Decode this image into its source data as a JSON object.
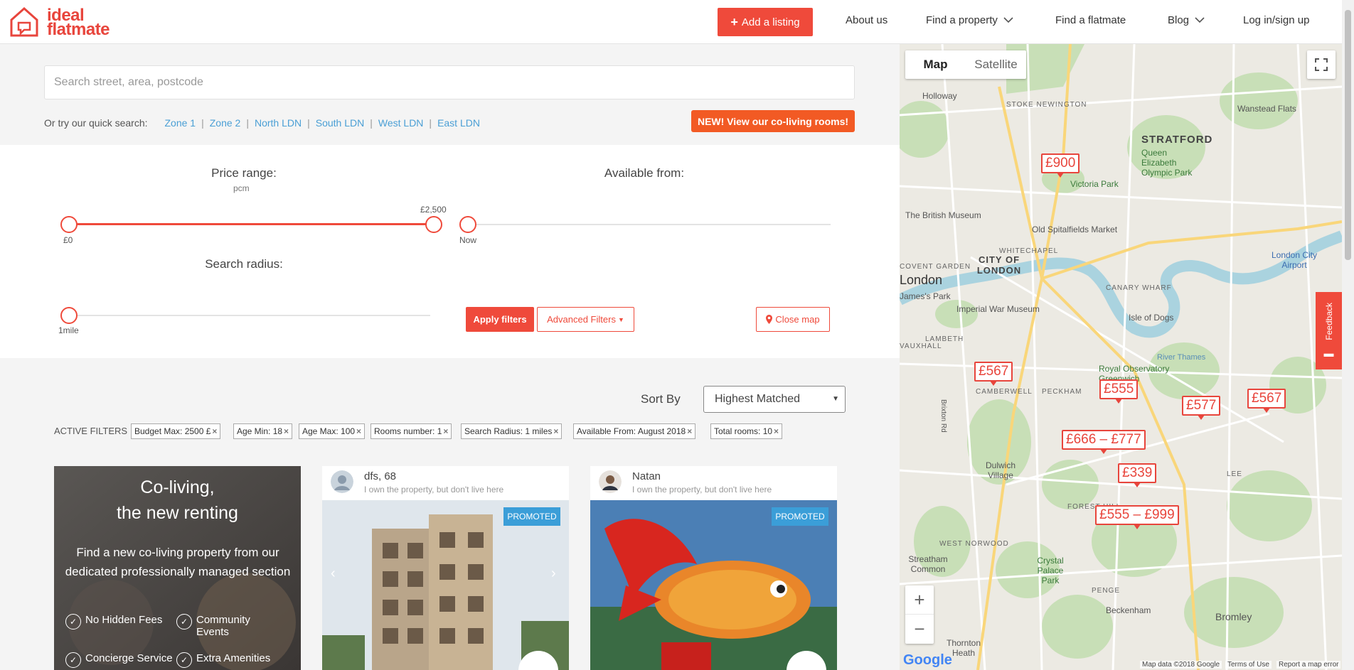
{
  "header": {
    "logo_line1": "ideal",
    "logo_line2": "flatmate",
    "add_listing": "Add a listing",
    "nav": [
      {
        "label": "About us"
      },
      {
        "label": "Find a property"
      },
      {
        "label": "Find a flatmate"
      },
      {
        "label": "Blog"
      },
      {
        "label": "Log in/sign up"
      }
    ]
  },
  "search": {
    "placeholder": "Search street, area, postcode",
    "quick_label": "Or try our quick search:",
    "quick_links": [
      "Zone 1",
      "Zone 2",
      "North LDN",
      "South LDN",
      "West LDN",
      "East LDN"
    ],
    "coliving_button": "NEW! View our co-living rooms!"
  },
  "filters": {
    "price_label": "Price range:",
    "price_unit": "pcm",
    "price_min_label": "£0",
    "price_max_label": "£2,500",
    "price_min": 0,
    "price_max": 2500,
    "available_label": "Available from:",
    "available_value": "Now",
    "radius_label": "Search radius:",
    "radius_value": "1mile",
    "apply": "Apply filters",
    "advanced": "Advanced Filters",
    "close_map": "Close map"
  },
  "results": {
    "sort_label": "Sort By",
    "sort_value": "Highest Matched",
    "active_label": "ACTIVE FILTERS",
    "chips": [
      "Budget Max: 2500 £",
      "Age Min: 18",
      "Age Max: 100",
      "Rooms number: 1",
      "Search Radius: 1 miles",
      "Available From: August 2018",
      "Total rooms: 10"
    ]
  },
  "promo_card": {
    "title_line1": "Co-living,",
    "title_line2": "the new renting",
    "description": "Find a new co-living property from our dedicated professionally managed section",
    "features": [
      "No Hidden Fees",
      "Community Events",
      "Concierge Service",
      "Extra Amenities"
    ]
  },
  "listings": [
    {
      "owner": "dfs, 68",
      "role": "I own the property, but don't live here",
      "badge": "PROMOTED"
    },
    {
      "owner": "Natan",
      "role": "I own the property, but don't live here",
      "badge": "PROMOTED"
    }
  ],
  "map": {
    "type_options": [
      "Map",
      "Satellite"
    ],
    "prices": [
      "£900",
      "£567",
      "£555",
      "£577",
      "£567",
      "£666 – £777",
      "£339",
      "£555 – £999"
    ],
    "places": {
      "holloway": "Holloway",
      "stratford": "STRATFORD",
      "wanstead": "Wanstead Flats",
      "olympic": "Queen Elizabeth Olympic Park",
      "victoria": "Victoria Park",
      "museum": "The British Museum",
      "spitalfields": "Old Spitalfields Market",
      "city": "CITY OF LONDON",
      "london": "London",
      "airport": "London City Airport",
      "iwm": "Imperial War Museum",
      "dogs": "Isle of Dogs",
      "observatory": "Royal Observatory Greenwich",
      "camberwell": "CAMBERWELL",
      "peckham": "PECKHAM",
      "dulwich": "Dulwich Village",
      "forest": "FOREST HILL",
      "lee": "LEE",
      "norwood": "WEST NORWOOD",
      "streatham": "Streatham Common",
      "crystal": "Crystal Palace Park",
      "penge": "PENGE",
      "beckenham": "Beckenham",
      "bromley": "Bromley",
      "thornton": "Thornton Heath",
      "whitechapel": "WHITECHAPEL",
      "canary": "CANARY WHARF",
      "lambeth": "LAMBETH",
      "vauxhall": "VAUXHALL",
      "covent": "COVENT GARDEN",
      "james": "James's Park",
      "brixton": "Brixton Rd",
      "river": "River Thames",
      "stoke": "STOKE NEWINGTON"
    },
    "footer": [
      "Map data ©2018 Google",
      "Terms of Use",
      "Report a map error"
    ],
    "google": "Google",
    "feedback": "Feedback"
  }
}
